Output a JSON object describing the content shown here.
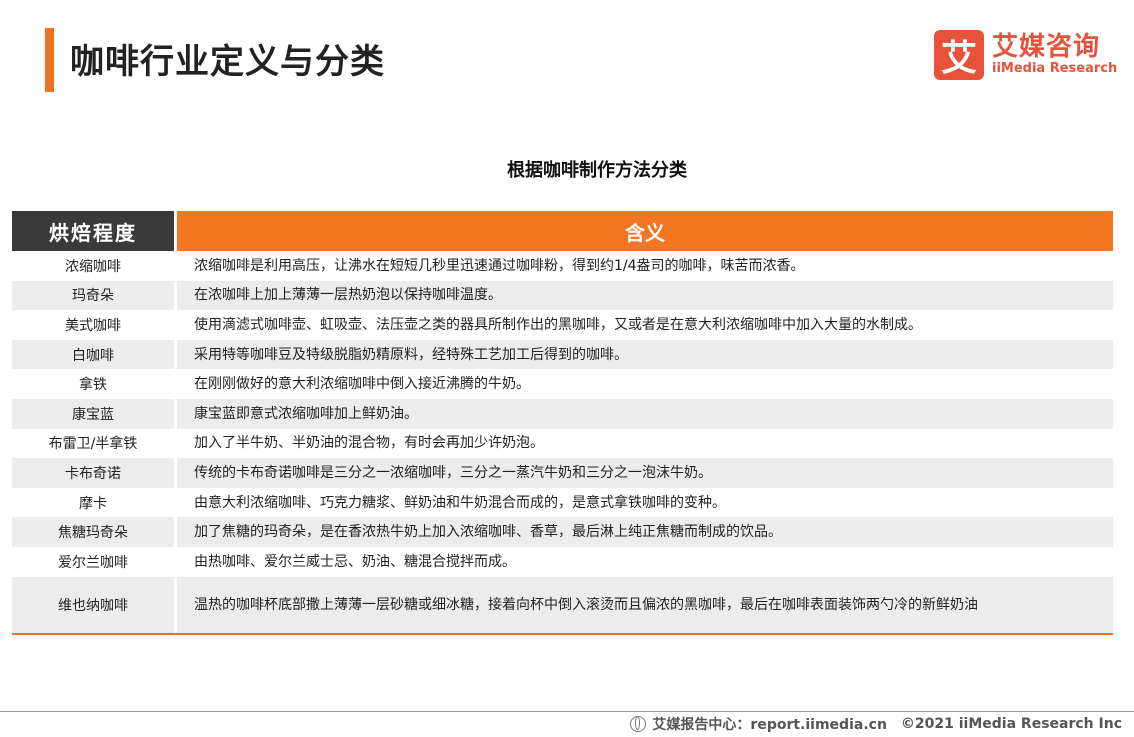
{
  "header": {
    "title": "咖啡行业定义与分类",
    "logo_mark": "艾",
    "logo_cn": "艾媒咨询",
    "logo_en": "iiMedia Research"
  },
  "table": {
    "caption": "根据咖啡制作方法分类",
    "col1_header": "烘焙程度",
    "col2_header": "含义",
    "rows": [
      {
        "name": "浓缩咖啡",
        "desc": "浓缩咖啡是利用高压，让沸水在短短几秒里迅速通过咖啡粉，得到约1/4盎司的咖啡，味苦而浓香。"
      },
      {
        "name": "玛奇朵",
        "desc": "在浓咖啡上加上薄薄一层热奶泡以保持咖啡温度。"
      },
      {
        "name": "美式咖啡",
        "desc": "使用滴滤式咖啡壶、虹吸壶、法压壶之类的器具所制作出的黑咖啡，又或者是在意大利浓缩咖啡中加入大量的水制成。"
      },
      {
        "name": "白咖啡",
        "desc": "采用特等咖啡豆及特级脱脂奶精原料，经特殊工艺加工后得到的咖啡。"
      },
      {
        "name": "拿铁",
        "desc": "在刚刚做好的意大利浓缩咖啡中倒入接近沸腾的牛奶。"
      },
      {
        "name": "康宝蓝",
        "desc": "康宝蓝即意式浓缩咖啡加上鲜奶油。"
      },
      {
        "name": "布雷卫/半拿铁",
        "desc": "加入了半牛奶、半奶油的混合物，有时会再加少许奶泡。"
      },
      {
        "name": "卡布奇诺",
        "desc": "传统的卡布奇诺咖啡是三分之一浓缩咖啡，三分之一蒸汽牛奶和三分之一泡沫牛奶。"
      },
      {
        "name": "摩卡",
        "desc": "由意大利浓缩咖啡、巧克力糖浆、鲜奶油和牛奶混合而成的，是意式拿铁咖啡的变种。"
      },
      {
        "name": "焦糖玛奇朵",
        "desc": "加了焦糖的玛奇朵，是在香浓热牛奶上加入浓缩咖啡、香草，最后淋上纯正焦糖而制成的饮品。"
      },
      {
        "name": "爱尔兰咖啡",
        "desc": "由热咖啡、爱尔兰威士忌、奶油、糖混合搅拌而成。"
      },
      {
        "name": "维也纳咖啡",
        "desc": "温热的咖啡杯底部撒上薄薄一层砂糖或细冰糖，接着向杯中倒入滚烫而且偏浓的黑咖啡，最后在咖啡表面装饰两勺冷的新鲜奶油"
      }
    ]
  },
  "footer": {
    "source": "艾媒报告中心：report.iimedia.cn",
    "copyright": "©2021  iiMedia Research  Inc"
  }
}
